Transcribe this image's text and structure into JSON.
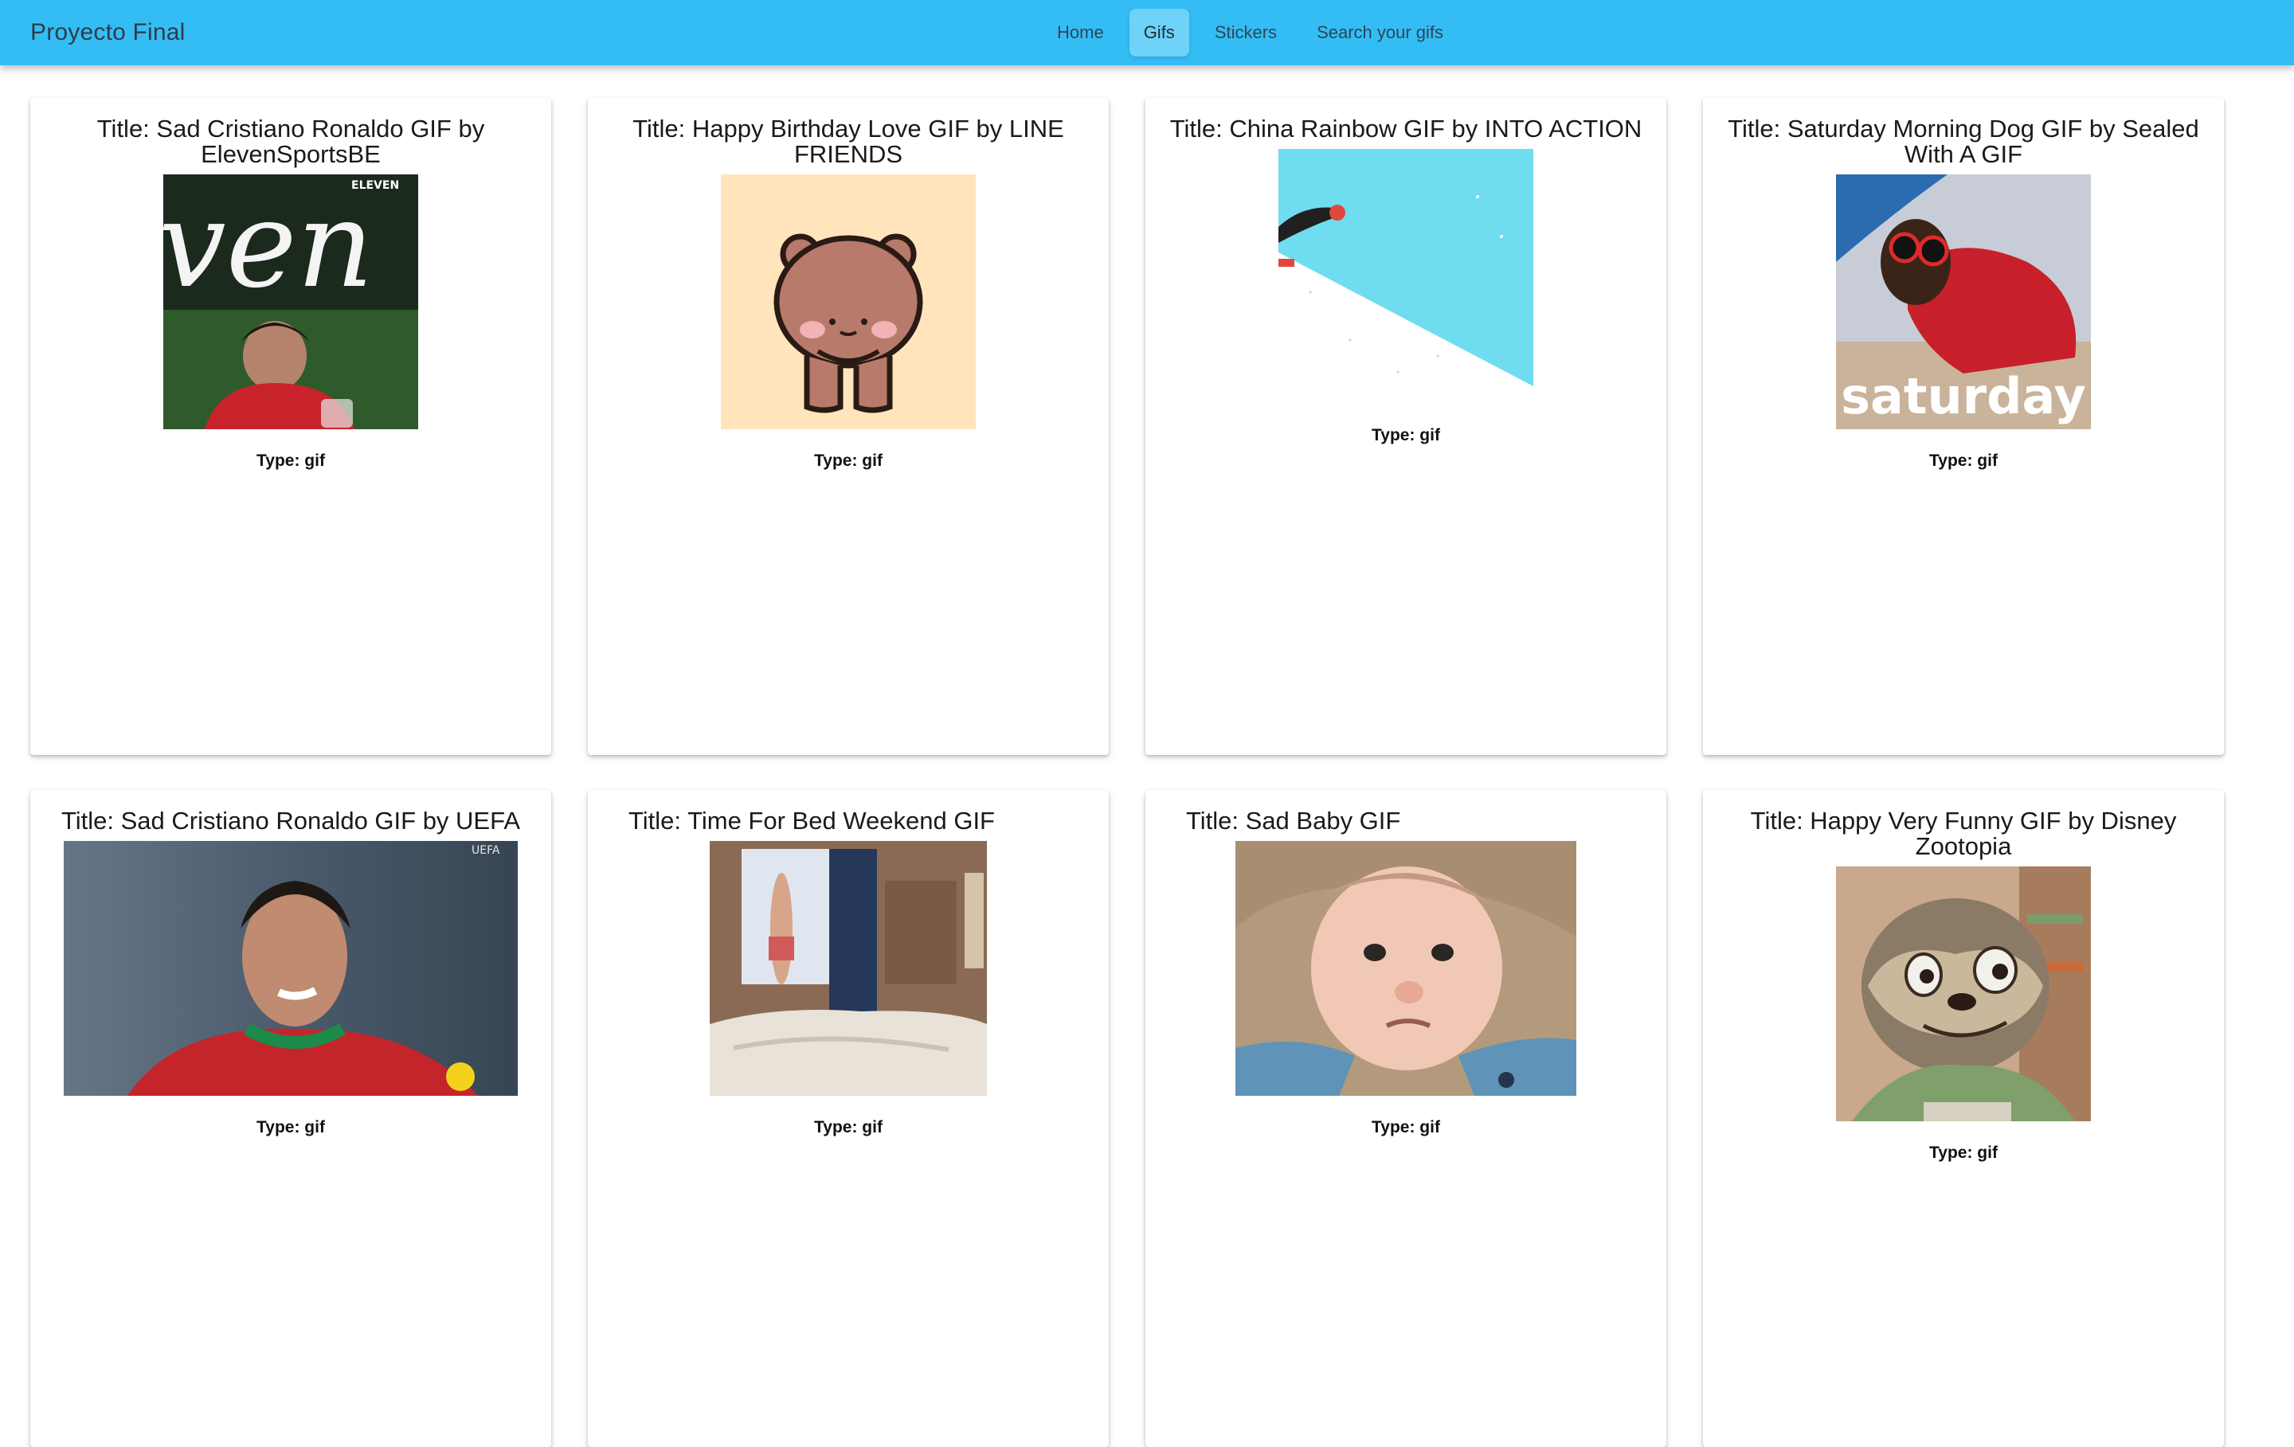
{
  "header": {
    "brand": "Proyecto Final",
    "nav": [
      {
        "label": "Home",
        "active": false
      },
      {
        "label": "Gifs",
        "active": true
      },
      {
        "label": "Stickers",
        "active": false
      },
      {
        "label": "Search your gifs",
        "active": false
      }
    ],
    "color": "#34bdf4"
  },
  "cards": [
    {
      "title": "Title: Sad Cristiano Ronaldo GIF by ElevenSportsBE",
      "type": "Type: gif",
      "image": "ronaldo-eleven-gif",
      "watermark": "ELEVEN",
      "overlay_text": "ven"
    },
    {
      "title": "Title: Happy Birthday Love GIF by LINE FRIENDS",
      "type": "Type: gif",
      "image": "brown-bear-gif"
    },
    {
      "title": "Title: China Rainbow GIF by INTO ACTION",
      "type": "Type: gif",
      "image": "skier-on-rainbow-gif"
    },
    {
      "title": "Title: Saturday Morning Dog GIF by Sealed With A GIF",
      "type": "Type: gif",
      "image": "dachshund-saturday-gif",
      "overlay_text": "saturday"
    },
    {
      "title": "Title: Sad Cristiano Ronaldo GIF by UEFA",
      "type": "Type: gif",
      "image": "ronaldo-uefa-gif",
      "watermark": "UEFA"
    },
    {
      "title": "Title: Time For Bed Weekend GIF",
      "type": "Type: gif",
      "image": "bedroom-gif"
    },
    {
      "title": "Title: Sad Baby GIF",
      "type": "Type: gif",
      "image": "sad-baby-gif"
    },
    {
      "title": "Title: Happy Very Funny GIF by Disney Zootopia",
      "type": "Type: gif",
      "image": "sloth-zootopia-gif"
    }
  ]
}
